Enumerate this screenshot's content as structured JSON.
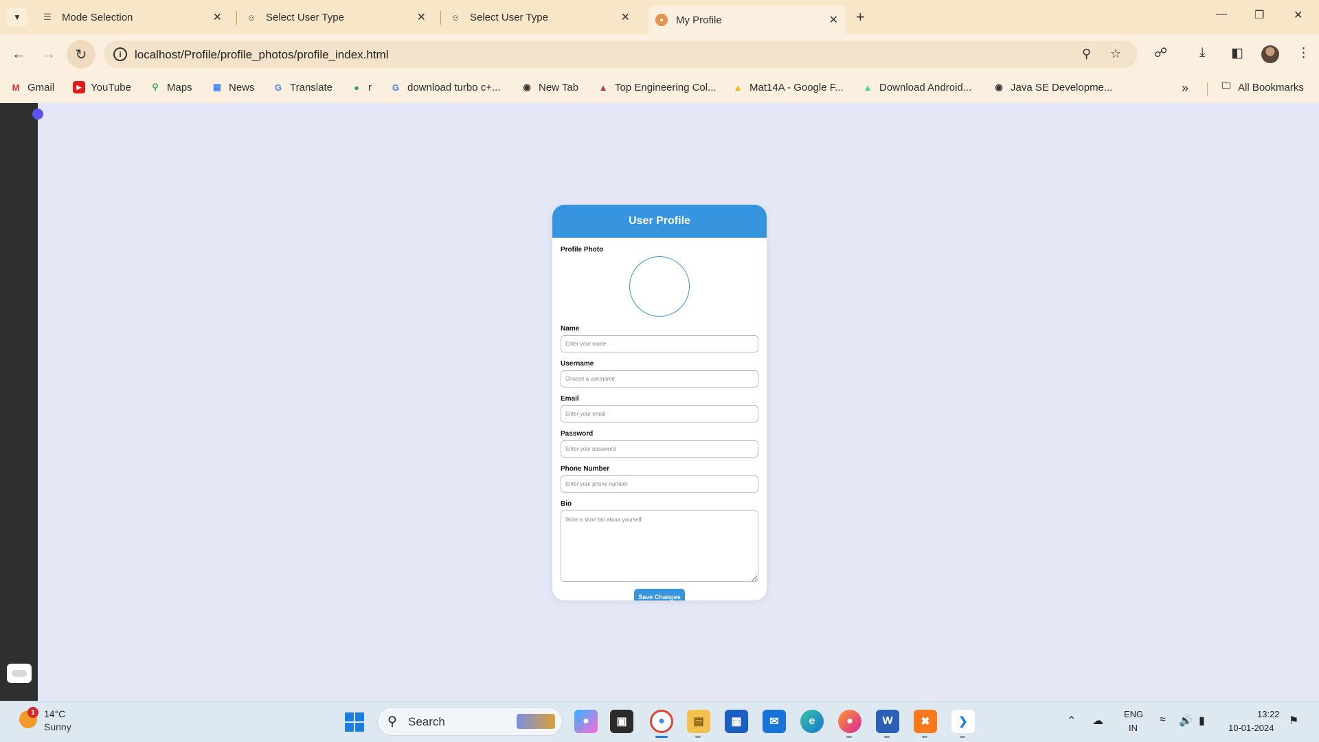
{
  "browser": {
    "tabs": [
      {
        "title": "Mode Selection",
        "icon": "sliders-icon",
        "active": false
      },
      {
        "title": "Select User Type",
        "icon": "users-icon",
        "active": false
      },
      {
        "title": "Select User Type",
        "icon": "users-icon",
        "active": false
      },
      {
        "title": "My Profile",
        "icon": "profile-icon",
        "active": true
      }
    ],
    "url": "localhost/Profile/profile_photos/profile_index.html",
    "bookmarks": [
      {
        "label": "Gmail",
        "icon": "gmail-icon"
      },
      {
        "label": "YouTube",
        "icon": "youtube-icon"
      },
      {
        "label": "Maps",
        "icon": "maps-icon"
      },
      {
        "label": "News",
        "icon": "news-icon"
      },
      {
        "label": "Translate",
        "icon": "translate-icon"
      },
      {
        "label": "r",
        "icon": "google-icon"
      },
      {
        "label": "download turbo c+...",
        "icon": "google-icon"
      },
      {
        "label": "New Tab",
        "icon": "globe-icon"
      },
      {
        "label": "Top Engineering Col...",
        "icon": "college-icon"
      },
      {
        "label": "Mat14A - Google F...",
        "icon": "drive-icon"
      },
      {
        "label": "Download Android...",
        "icon": "android-icon"
      },
      {
        "label": "Java SE Developme...",
        "icon": "globe-icon"
      }
    ],
    "all_bookmarks": "All Bookmarks"
  },
  "profile": {
    "title": "User Profile",
    "photo_label": "Profile Photo",
    "fields": {
      "name": {
        "label": "Name",
        "placeholder": "Enter your name"
      },
      "username": {
        "label": "Username",
        "placeholder": "Choose a username"
      },
      "email": {
        "label": "Email",
        "placeholder": "Enter your email"
      },
      "password": {
        "label": "Password",
        "placeholder": "Enter your password"
      },
      "phone": {
        "label": "Phone Number",
        "placeholder": "Enter your phone number"
      },
      "bio": {
        "label": "Bio",
        "placeholder": "Write a short bio about yourself"
      }
    },
    "save_label": "Save Changes",
    "accent_color": "#3794de"
  },
  "taskbar": {
    "weather": {
      "temp": "14°C",
      "desc": "Sunny",
      "badge": "1"
    },
    "search_label": "Search",
    "language": {
      "line1": "ENG",
      "line2": "IN"
    },
    "clock": {
      "time": "13:22",
      "date": "10-01-2024"
    }
  }
}
